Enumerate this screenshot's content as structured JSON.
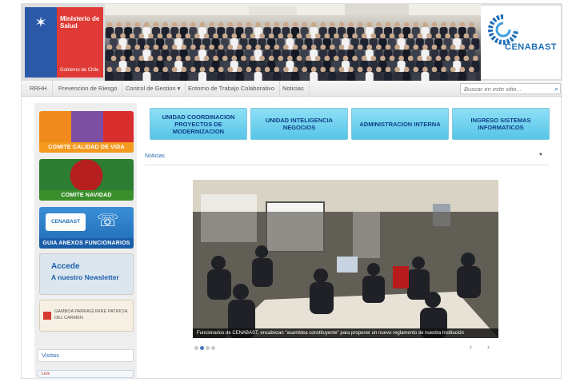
{
  "header": {
    "gov_title": "Ministerio de Salud",
    "gov_subtitle": "Gobierno de Chile",
    "brand": "CENABAST",
    "colors": {
      "gov_blue": "#2b59a8",
      "gov_red": "#e03a36",
      "brand_blue": "#1f6fb5"
    }
  },
  "nav": {
    "items": [
      {
        "label": "RRHH"
      },
      {
        "label": "Prevencion de Riesgo"
      },
      {
        "label": "Control de Gestion ▾"
      },
      {
        "label": "Entorno de Trabajo Colaborativo"
      },
      {
        "label": "Noticias"
      }
    ],
    "search_placeholder": "Buscar en este sitio...",
    "search_icon": "search-icon"
  },
  "sidebar": {
    "banners": [
      {
        "caption": "COMITE CALIDAD DE VIDA"
      },
      {
        "caption": "COMITE NAVIDAD"
      },
      {
        "caption": "GUIA ANEXOS FUNCIONARIOS",
        "brand": "CENABAST"
      },
      {
        "line1": "Accede",
        "line2": "A nuestro Newsletter"
      },
      {
        "text": "GAMBOA PARRAGUIRRE PATRICIA DEL CARMEN"
      }
    ],
    "widgets": {
      "visitas": "Visitas",
      "links": "Link"
    }
  },
  "main": {
    "tiles": [
      {
        "label": "UNIDAD COORDINACION PROYECTOS DE MODERNIZACION"
      },
      {
        "label": "UNIDAD INTELIGENCIA NEGOCIOS"
      },
      {
        "label": "ADMINISTRACION INTERNA"
      },
      {
        "label": "INGRESO SISTEMAS INFORMATICOS"
      }
    ],
    "section_label": "Noticias",
    "slide_caption": "Funcionarios de CENABAST, encabezan \"asamblea constituyente\" para proponer un nuevo reglamento de nuestra Institución",
    "carousel": {
      "prev": "‹",
      "next": "›",
      "count": 4,
      "active": 2
    }
  }
}
